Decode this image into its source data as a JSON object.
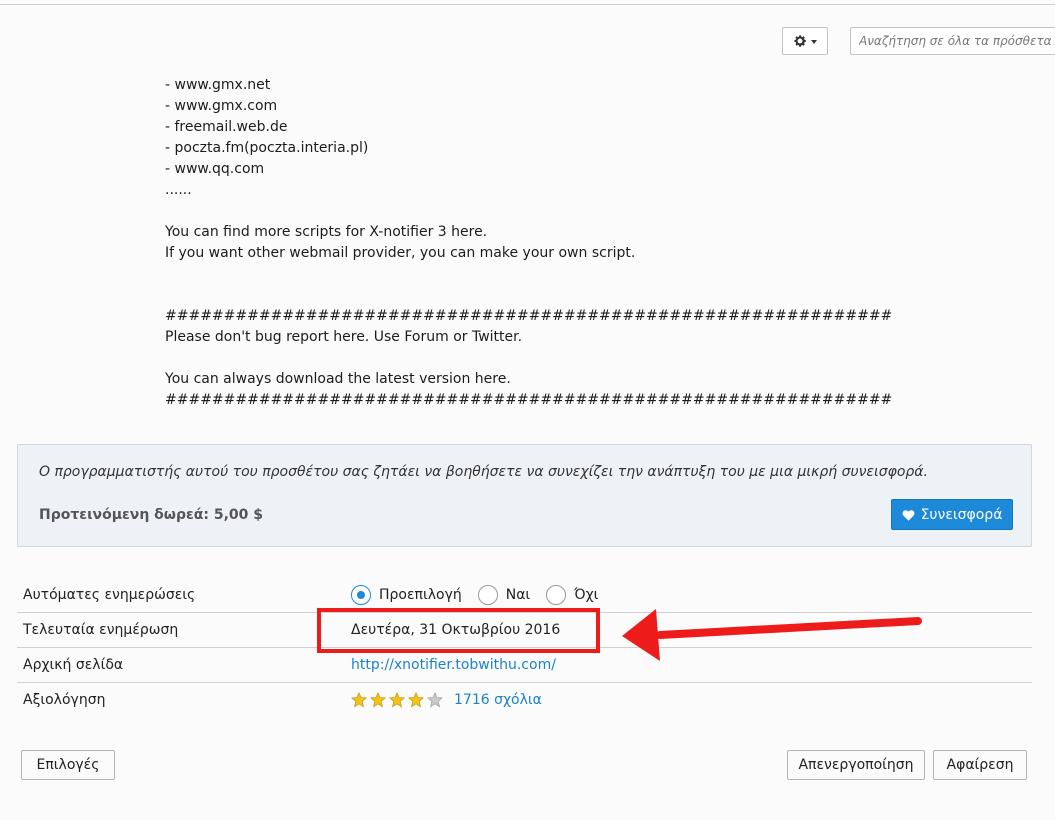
{
  "toolbar": {
    "gear_icon": "gear-icon",
    "search_placeholder": "Αναζήτηση σε όλα τα πρόσθετα"
  },
  "description": {
    "lines": [
      "- www.gmx.net",
      "- www.gmx.com",
      "- freemail.web.de",
      "- poczta.fm(poczta.interia.pl)",
      "- www.qq.com",
      "......",
      "",
      "You can find more scripts for X-notifier 3 here.",
      "If you want other webmail provider, you can make your own script.",
      "",
      "",
      "##############################################################",
      "Please don't bug report here. Use Forum or Twitter.",
      "",
      "You can always download the latest version here.",
      "##############################################################"
    ]
  },
  "contribution": {
    "message": "Ο προγραμματιστής αυτού του προσθέτου σας ζητάει να βοηθήσετε να συνεχίζει την ανάπτυξη του με μια μικρή συνεισφορά.",
    "suggested_label": "Προτεινόμενη δωρεά: 5,00 $",
    "button_label": "Συνεισφορά",
    "button_color": "#1c8ad8"
  },
  "details": {
    "auto_updates": {
      "label": "Αυτόματες ενημερώσεις",
      "options": [
        "Προεπιλογή",
        "Ναι",
        "Όχι"
      ],
      "selected": "Προεπιλογή"
    },
    "last_updated": {
      "label": "Τελευταία ενημέρωση",
      "value": "Δευτέρα, 31 Οκτωβρίου 2016"
    },
    "homepage": {
      "label": "Αρχική σελίδα",
      "value": "http://xnotifier.tobwithu.com/"
    },
    "rating": {
      "label": "Αξιολόγηση",
      "stars": 4,
      "max_stars": 5,
      "reviews": "1716 σχόλια"
    }
  },
  "annotation": {
    "highlight_color": "#ee1b1b"
  },
  "footer": {
    "options_label": "Επιλογές",
    "disable_label": "Απενεργοποίηση",
    "remove_label": "Αφαίρεση"
  }
}
